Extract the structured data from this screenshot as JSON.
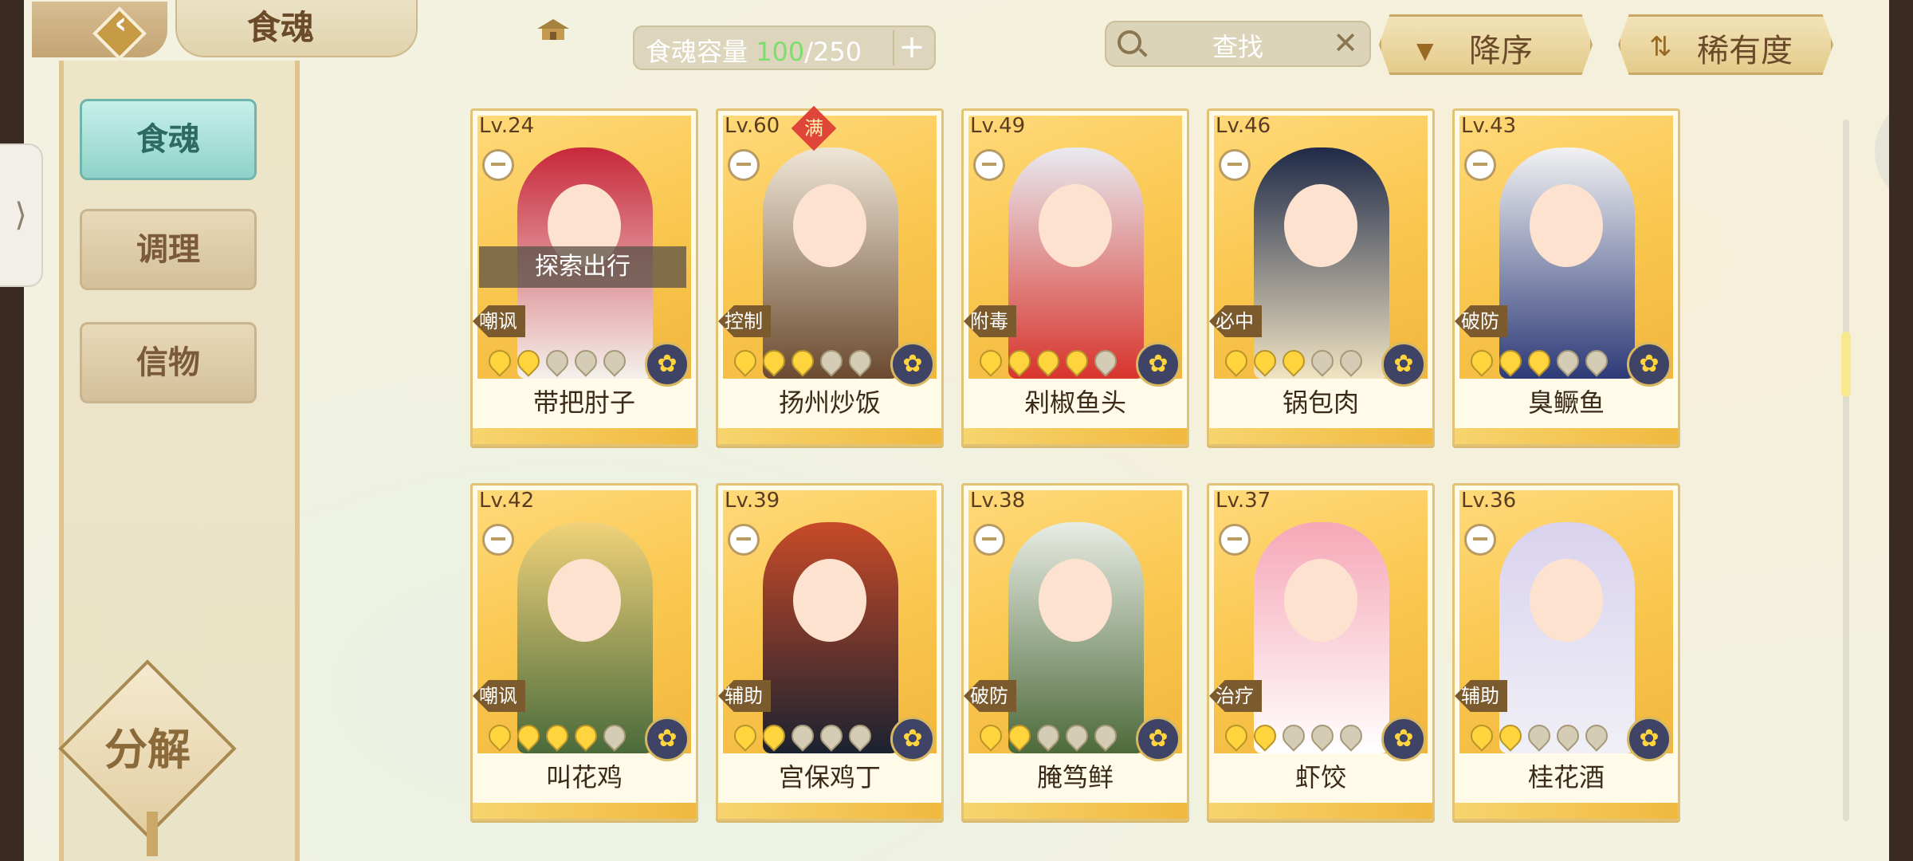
{
  "header": {
    "title": "食魂",
    "capacity_label": "食魂容量",
    "capacity_current": "100",
    "capacity_total": "/250",
    "search_placeholder": "查找",
    "sort_order_label": "降序",
    "sort_by_label": "稀有度"
  },
  "sidebar": {
    "items": [
      {
        "label": "食魂",
        "active": true
      },
      {
        "label": "调理",
        "active": false
      },
      {
        "label": "信物",
        "active": false
      }
    ],
    "decompose_label": "分解"
  },
  "colors": {
    "accent": "#8fd2c9",
    "card_gold": "#f9c64d",
    "capacity_highlight": "#7dde6a"
  },
  "cards": [
    {
      "level": "Lv.24",
      "role": "嘲讽",
      "stars": 2,
      "name": "带把肘子",
      "status": "探索出行",
      "maxed": false
    },
    {
      "level": "Lv.60",
      "role": "控制",
      "stars": 3,
      "name": "扬州炒饭",
      "status": "",
      "maxed": true,
      "maxed_label": "满"
    },
    {
      "level": "Lv.49",
      "role": "附毒",
      "stars": 4,
      "name": "剁椒鱼头",
      "status": "",
      "maxed": false
    },
    {
      "level": "Lv.46",
      "role": "必中",
      "stars": 3,
      "name": "锅包肉",
      "status": "",
      "maxed": false
    },
    {
      "level": "Lv.43",
      "role": "破防",
      "stars": 3,
      "name": "臭鳜鱼",
      "status": "",
      "maxed": false
    },
    {
      "level": "Lv.42",
      "role": "嘲讽",
      "stars": 4,
      "name": "叫花鸡",
      "status": "",
      "maxed": false
    },
    {
      "level": "Lv.39",
      "role": "辅助",
      "stars": 2,
      "name": "宫保鸡丁",
      "status": "",
      "maxed": false
    },
    {
      "level": "Lv.38",
      "role": "破防",
      "stars": 2,
      "name": "腌笃鲜",
      "status": "",
      "maxed": false
    },
    {
      "level": "Lv.37",
      "role": "治疗",
      "stars": 2,
      "name": "虾饺",
      "status": "",
      "maxed": false
    },
    {
      "level": "Lv.36",
      "role": "辅助",
      "stars": 2,
      "name": "桂花酒",
      "status": "",
      "maxed": false
    }
  ]
}
